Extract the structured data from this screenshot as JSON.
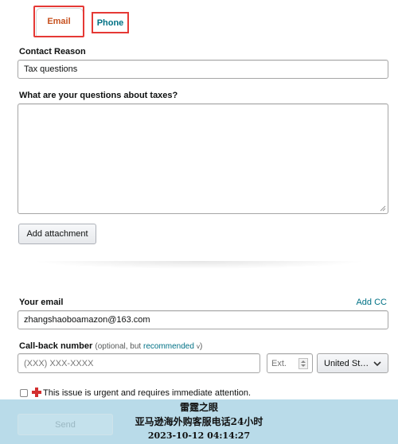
{
  "tabs": {
    "email_label": "Email",
    "phone_label": "Phone"
  },
  "contact_reason": {
    "label": "Contact Reason",
    "value": "Tax questions"
  },
  "taxes_question": {
    "label": "What are your questions about taxes?",
    "value": ""
  },
  "attachment": {
    "button_label": "Add attachment"
  },
  "email": {
    "label": "Your email",
    "add_cc_label": "Add CC",
    "value": "zhangshaoboamazon@163.com"
  },
  "callback": {
    "label": "Call-back number",
    "note_prefix": "(optional, but ",
    "note_link": "recommended",
    "note_suffix": ")",
    "chevron": "v",
    "phone_placeholder": "(XXX) XXX-XXXX",
    "ext_placeholder": "Ext.",
    "country_value": "United St…"
  },
  "urgent": {
    "text": "This issue is urgent and requires immediate attention."
  },
  "send": {
    "button_label": "Send"
  },
  "watermark": {
    "line1": "雷霆之眼",
    "line2": "亚马逊海外购客服电话24小时",
    "line3": "2023-10-12 04:14:27"
  },
  "colors": {
    "accent_orange": "#c7511f",
    "link_teal": "#007185",
    "highlight_red": "#e53935",
    "overlay_blue": "#b9dbe9"
  }
}
